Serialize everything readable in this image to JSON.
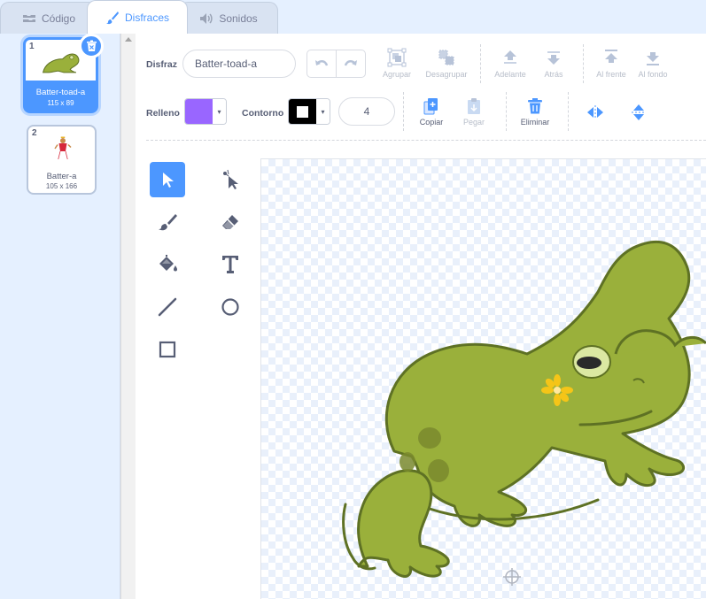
{
  "tabs": {
    "code": "Código",
    "costumes": "Disfraces",
    "sounds": "Sonidos"
  },
  "costumes": [
    {
      "number": "1",
      "name": "Batter-toad-a",
      "size": "115 x 89"
    },
    {
      "number": "2",
      "name": "Batter-a",
      "size": "105 x 166"
    }
  ],
  "toolbar": {
    "costume_label": "Disfraz",
    "costume_name": "Batter-toad-a",
    "group": "Agrupar",
    "ungroup": "Desagrupar",
    "forward": "Adelante",
    "backward": "Atrás",
    "front": "Al frente",
    "back": "Al fondo",
    "fill_label": "Relleno",
    "fill_color": "#9966ff",
    "outline_label": "Contorno",
    "outline_color": "#000000",
    "outline_width": "4",
    "copy": "Copiar",
    "paste": "Pegar",
    "delete": "Eliminar"
  },
  "colors": {
    "accent": "#4c97ff",
    "toad_body": "#9ab03b",
    "toad_outline": "#5e7124"
  },
  "tools": [
    "select",
    "reshape",
    "brush",
    "eraser",
    "fill",
    "text",
    "line",
    "circle",
    "rectangle"
  ]
}
